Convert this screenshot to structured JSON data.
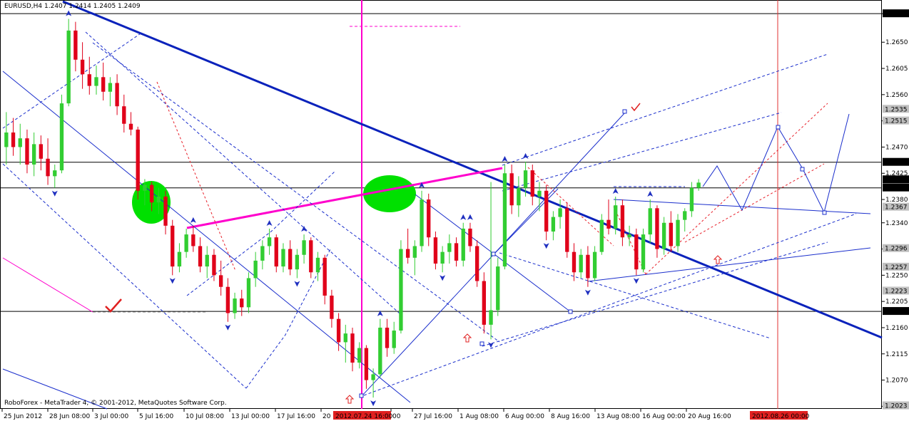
{
  "chart_data": {
    "type": "candlestick",
    "symbol": "EURUSD,H4",
    "ohlc_header": "1.2407 1.2414 1.2405 1.2409",
    "copyright": "RoboForex - MetaTrader 4, © 2001-2012, MetaQuotes Software Corp.",
    "ylim": [
      1.2023,
      1.272
    ],
    "y_ticks": [
      "1.2699",
      "1.2650",
      "1.2605",
      "1.2560",
      "1.2515",
      "1.2470",
      "1.2425",
      "1.2380",
      "1.2340",
      "1.2295",
      "1.2250",
      "1.2205",
      "1.2160",
      "1.2115",
      "1.2070",
      "1.2025"
    ],
    "price_labels": [
      {
        "text": "1.2699",
        "value": 1.2699,
        "style": "dark"
      },
      {
        "text": "1.2535",
        "value": 1.2535,
        "style": "grey"
      },
      {
        "text": "1.2515",
        "value": 1.2515,
        "style": "grey"
      },
      {
        "text": "1.2444",
        "value": 1.2444,
        "style": "dark"
      },
      {
        "text": "1.2409",
        "value": 1.2414,
        "style": "dark"
      },
      {
        "text": "1.2400",
        "value": 1.24,
        "style": "dark"
      },
      {
        "text": "1.2367",
        "value": 1.2367,
        "style": "grey"
      },
      {
        "text": "1.2296",
        "value": 1.2296,
        "style": "grey"
      },
      {
        "text": "1.2257",
        "value": 1.2264,
        "style": "grey"
      },
      {
        "text": "1.2223",
        "value": 1.2223,
        "style": "grey"
      },
      {
        "text": "1.2188",
        "value": 1.2188,
        "style": "dark"
      },
      {
        "text": "1.2023",
        "value": 1.2026,
        "style": "grey"
      }
    ],
    "horizontal_levels": [
      1.2699,
      1.2444,
      1.24,
      1.2188
    ],
    "x_labels": [
      "25 Jun 2012",
      "28 Jun 08:00",
      "3 Jul 00:00",
      "5 Jul 16:00",
      "10 Jul 08:00",
      "13 Jul 00:00",
      "17 Jul 16:00",
      "20",
      "00",
      "27 Jul 16:00",
      "1 Aug 08:00",
      "6 Aug 00:00",
      "8 Aug 16:00",
      "13 Aug 08:00",
      "16 Aug 00:00",
      "20 Aug 16:00"
    ],
    "highlighted_x_labels": [
      "2012.07.24 16:00",
      "2012.08.26 00:00"
    ],
    "candles": [
      {
        "o": 1.247,
        "h": 1.253,
        "l": 1.244,
        "c": 1.2495
      },
      {
        "o": 1.2495,
        "h": 1.252,
        "l": 1.2455,
        "c": 1.247
      },
      {
        "o": 1.247,
        "h": 1.251,
        "l": 1.244,
        "c": 1.2485
      },
      {
        "o": 1.2485,
        "h": 1.25,
        "l": 1.2425,
        "c": 1.244
      },
      {
        "o": 1.244,
        "h": 1.2495,
        "l": 1.242,
        "c": 1.2475
      },
      {
        "o": 1.2475,
        "h": 1.249,
        "l": 1.243,
        "c": 1.245
      },
      {
        "o": 1.245,
        "h": 1.2485,
        "l": 1.2405,
        "c": 1.242
      },
      {
        "o": 1.242,
        "h": 1.244,
        "l": 1.24,
        "c": 1.243
      },
      {
        "o": 1.243,
        "h": 1.256,
        "l": 1.2425,
        "c": 1.2545
      },
      {
        "o": 1.2545,
        "h": 1.269,
        "l": 1.254,
        "c": 1.267
      },
      {
        "o": 1.267,
        "h": 1.2685,
        "l": 1.26,
        "c": 1.262
      },
      {
        "o": 1.262,
        "h": 1.265,
        "l": 1.257,
        "c": 1.2595
      },
      {
        "o": 1.2595,
        "h": 1.2625,
        "l": 1.256,
        "c": 1.2575
      },
      {
        "o": 1.2575,
        "h": 1.261,
        "l": 1.256,
        "c": 1.259
      },
      {
        "o": 1.259,
        "h": 1.2615,
        "l": 1.255,
        "c": 1.2565
      },
      {
        "o": 1.2565,
        "h": 1.259,
        "l": 1.254,
        "c": 1.258
      },
      {
        "o": 1.258,
        "h": 1.2595,
        "l": 1.2525,
        "c": 1.254
      },
      {
        "o": 1.254,
        "h": 1.256,
        "l": 1.2495,
        "c": 1.251
      },
      {
        "o": 1.251,
        "h": 1.253,
        "l": 1.249,
        "c": 1.25
      },
      {
        "o": 1.25,
        "h": 1.2505,
        "l": 1.238,
        "c": 1.2395
      },
      {
        "o": 1.2395,
        "h": 1.2415,
        "l": 1.237,
        "c": 1.2405
      },
      {
        "o": 1.2405,
        "h": 1.241,
        "l": 1.236,
        "c": 1.2375
      },
      {
        "o": 1.2375,
        "h": 1.24,
        "l": 1.2355,
        "c": 1.2385
      },
      {
        "o": 1.2385,
        "h": 1.2395,
        "l": 1.232,
        "c": 1.2335
      },
      {
        "o": 1.2335,
        "h": 1.2345,
        "l": 1.225,
        "c": 1.2265
      },
      {
        "o": 1.2265,
        "h": 1.2305,
        "l": 1.2255,
        "c": 1.229
      },
      {
        "o": 1.229,
        "h": 1.233,
        "l": 1.228,
        "c": 1.232
      },
      {
        "o": 1.232,
        "h": 1.2335,
        "l": 1.229,
        "c": 1.23
      },
      {
        "o": 1.23,
        "h": 1.2315,
        "l": 1.2255,
        "c": 1.2265
      },
      {
        "o": 1.2265,
        "h": 1.23,
        "l": 1.2245,
        "c": 1.2285
      },
      {
        "o": 1.2285,
        "h": 1.2295,
        "l": 1.224,
        "c": 1.225
      },
      {
        "o": 1.225,
        "h": 1.2275,
        "l": 1.2215,
        "c": 1.223
      },
      {
        "o": 1.223,
        "h": 1.2245,
        "l": 1.217,
        "c": 1.2185
      },
      {
        "o": 1.2185,
        "h": 1.222,
        "l": 1.2175,
        "c": 1.221
      },
      {
        "o": 1.221,
        "h": 1.2225,
        "l": 1.218,
        "c": 1.2195
      },
      {
        "o": 1.2195,
        "h": 1.2255,
        "l": 1.2185,
        "c": 1.2245
      },
      {
        "o": 1.2245,
        "h": 1.229,
        "l": 1.223,
        "c": 1.2275
      },
      {
        "o": 1.2275,
        "h": 1.231,
        "l": 1.226,
        "c": 1.23
      },
      {
        "o": 1.23,
        "h": 1.233,
        "l": 1.2285,
        "c": 1.2315
      },
      {
        "o": 1.2315,
        "h": 1.232,
        "l": 1.2255,
        "c": 1.2265
      },
      {
        "o": 1.2265,
        "h": 1.2305,
        "l": 1.2255,
        "c": 1.2295
      },
      {
        "o": 1.2295,
        "h": 1.231,
        "l": 1.225,
        "c": 1.226
      },
      {
        "o": 1.226,
        "h": 1.2295,
        "l": 1.2245,
        "c": 1.2285
      },
      {
        "o": 1.2285,
        "h": 1.232,
        "l": 1.227,
        "c": 1.231
      },
      {
        "o": 1.231,
        "h": 1.2315,
        "l": 1.2245,
        "c": 1.2255
      },
      {
        "o": 1.2255,
        "h": 1.229,
        "l": 1.224,
        "c": 1.228
      },
      {
        "o": 1.228,
        "h": 1.2285,
        "l": 1.22,
        "c": 1.2215
      },
      {
        "o": 1.2215,
        "h": 1.2225,
        "l": 1.216,
        "c": 1.2175
      },
      {
        "o": 1.2175,
        "h": 1.2185,
        "l": 1.212,
        "c": 1.2135
      },
      {
        "o": 1.2135,
        "h": 1.2165,
        "l": 1.21,
        "c": 1.215
      },
      {
        "o": 1.215,
        "h": 1.216,
        "l": 1.2085,
        "c": 1.21
      },
      {
        "o": 1.21,
        "h": 1.2135,
        "l": 1.209,
        "c": 1.2125
      },
      {
        "o": 1.2125,
        "h": 1.213,
        "l": 1.2055,
        "c": 1.207
      },
      {
        "o": 1.207,
        "h": 1.209,
        "l": 1.204,
        "c": 1.208
      },
      {
        "o": 1.208,
        "h": 1.2175,
        "l": 1.2075,
        "c": 1.216
      },
      {
        "o": 1.216,
        "h": 1.2175,
        "l": 1.211,
        "c": 1.2125
      },
      {
        "o": 1.2125,
        "h": 1.217,
        "l": 1.2115,
        "c": 1.2155
      },
      {
        "o": 1.2155,
        "h": 1.231,
        "l": 1.215,
        "c": 1.2295
      },
      {
        "o": 1.2295,
        "h": 1.233,
        "l": 1.227,
        "c": 1.228
      },
      {
        "o": 1.228,
        "h": 1.231,
        "l": 1.225,
        "c": 1.23
      },
      {
        "o": 1.23,
        "h": 1.2395,
        "l": 1.229,
        "c": 1.238
      },
      {
        "o": 1.238,
        "h": 1.239,
        "l": 1.23,
        "c": 1.2315
      },
      {
        "o": 1.2315,
        "h": 1.2325,
        "l": 1.226,
        "c": 1.227
      },
      {
        "o": 1.227,
        "h": 1.23,
        "l": 1.2255,
        "c": 1.229
      },
      {
        "o": 1.229,
        "h": 1.232,
        "l": 1.227,
        "c": 1.2305
      },
      {
        "o": 1.2305,
        "h": 1.2315,
        "l": 1.2265,
        "c": 1.2275
      },
      {
        "o": 1.2275,
        "h": 1.234,
        "l": 1.2265,
        "c": 1.233
      },
      {
        "o": 1.233,
        "h": 1.234,
        "l": 1.229,
        "c": 1.23
      },
      {
        "o": 1.23,
        "h": 1.231,
        "l": 1.223,
        "c": 1.224
      },
      {
        "o": 1.224,
        "h": 1.2255,
        "l": 1.215,
        "c": 1.2165
      },
      {
        "o": 1.2165,
        "h": 1.241,
        "l": 1.214,
        "c": 1.219
      },
      {
        "o": 1.219,
        "h": 1.228,
        "l": 1.218,
        "c": 1.2265
      },
      {
        "o": 1.2265,
        "h": 1.244,
        "l": 1.226,
        "c": 1.2425
      },
      {
        "o": 1.2425,
        "h": 1.244,
        "l": 1.2355,
        "c": 1.237
      },
      {
        "o": 1.237,
        "h": 1.242,
        "l": 1.235,
        "c": 1.24
      },
      {
        "o": 1.24,
        "h": 1.2445,
        "l": 1.2385,
        "c": 1.243
      },
      {
        "o": 1.243,
        "h": 1.244,
        "l": 1.237,
        "c": 1.2385
      },
      {
        "o": 1.2385,
        "h": 1.241,
        "l": 1.236,
        "c": 1.2395
      },
      {
        "o": 1.2395,
        "h": 1.2405,
        "l": 1.231,
        "c": 1.2325
      },
      {
        "o": 1.2325,
        "h": 1.236,
        "l": 1.231,
        "c": 1.235
      },
      {
        "o": 1.235,
        "h": 1.238,
        "l": 1.233,
        "c": 1.2365
      },
      {
        "o": 1.2365,
        "h": 1.2375,
        "l": 1.228,
        "c": 1.229
      },
      {
        "o": 1.229,
        "h": 1.2305,
        "l": 1.224,
        "c": 1.2255
      },
      {
        "o": 1.2255,
        "h": 1.2295,
        "l": 1.2245,
        "c": 1.2285
      },
      {
        "o": 1.2285,
        "h": 1.23,
        "l": 1.223,
        "c": 1.2245
      },
      {
        "o": 1.2245,
        "h": 1.23,
        "l": 1.224,
        "c": 1.229
      },
      {
        "o": 1.229,
        "h": 1.2355,
        "l": 1.2285,
        "c": 1.2345
      },
      {
        "o": 1.2345,
        "h": 1.238,
        "l": 1.232,
        "c": 1.233
      },
      {
        "o": 1.233,
        "h": 1.2385,
        "l": 1.232,
        "c": 1.237
      },
      {
        "o": 1.237,
        "h": 1.238,
        "l": 1.23,
        "c": 1.2315
      },
      {
        "o": 1.2315,
        "h": 1.2335,
        "l": 1.23,
        "c": 1.232
      },
      {
        "o": 1.232,
        "h": 1.233,
        "l": 1.225,
        "c": 1.226
      },
      {
        "o": 1.226,
        "h": 1.233,
        "l": 1.2255,
        "c": 1.232
      },
      {
        "o": 1.232,
        "h": 1.238,
        "l": 1.2305,
        "c": 1.2365
      },
      {
        "o": 1.2365,
        "h": 1.237,
        "l": 1.228,
        "c": 1.2295
      },
      {
        "o": 1.2295,
        "h": 1.235,
        "l": 1.2285,
        "c": 1.234
      },
      {
        "o": 1.234,
        "h": 1.236,
        "l": 1.229,
        "c": 1.23
      },
      {
        "o": 1.23,
        "h": 1.2355,
        "l": 1.229,
        "c": 1.2345
      },
      {
        "o": 1.2345,
        "h": 1.2365,
        "l": 1.2325,
        "c": 1.236
      },
      {
        "o": 1.236,
        "h": 1.241,
        "l": 1.235,
        "c": 1.24
      },
      {
        "o": 1.24,
        "h": 1.2415,
        "l": 1.2395,
        "c": 1.2409
      }
    ],
    "colors": {
      "bull": "#32cd32",
      "bear": "#e0001a",
      "wave": "#1a2ecc",
      "trend": "#0a22bb",
      "magenta": "#ff00cc",
      "forecast_red": "#e8202a",
      "highlight": "#00e000",
      "label_dark": "#000000",
      "label_grey": "#c0c0c0"
    },
    "icons": [
      "check-mark-icon",
      "up-arrow-outline-icon",
      "fractal-arrow-icon"
    ]
  }
}
